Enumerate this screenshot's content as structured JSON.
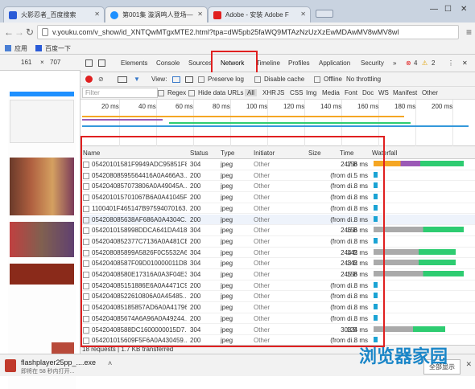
{
  "tabs": [
    {
      "title": "火影忍者_百度搜索",
      "favicon_color": "#2a5bd7"
    },
    {
      "title": "第001集 漩涡鸣人登场—",
      "favicon_color": "#1e90ff"
    },
    {
      "title": "Adobe - 安装 Adobe F",
      "favicon_color": "#e02020"
    }
  ],
  "address": {
    "url": "v.youku.com/v_show/id_XNTQwMTgxMTE2.html?tpa=dW5pb25faWQ9MTAzNzUzXzEwMDAwMV8wMV8wl"
  },
  "bookmarks": [
    "应用",
    "百度一下"
  ],
  "viewport": {
    "width": "161",
    "height": "707"
  },
  "devtools": {
    "tabs": [
      "Elements",
      "Console",
      "Sources",
      "Network",
      "Timeline",
      "Profiles",
      "Application",
      "Security",
      "»"
    ],
    "errors": "4",
    "warnings": "2",
    "controls": {
      "view": "View:",
      "preserve": "Preserve log",
      "disable_cache": "Disable cache",
      "offline": "Offline",
      "throttle": "No throttling"
    },
    "filter": {
      "placeholder": "Filter",
      "regex": "Regex",
      "hide": "Hide data URLs",
      "types": [
        "All",
        "XHR",
        "JS",
        "CSS",
        "Img",
        "Media",
        "Font",
        "Doc",
        "WS",
        "Manifest",
        "Other"
      ]
    }
  },
  "timeline_ticks": [
    "20 ms",
    "40 ms",
    "60 ms",
    "80 ms",
    "100 ms",
    "120 ms",
    "140 ms",
    "160 ms",
    "180 ms",
    "200 ms"
  ],
  "columns": [
    "Name",
    "Status",
    "Type",
    "Initiator",
    "Size",
    "Time",
    "Waterfall"
  ],
  "rows": [
    {
      "name": "05420101581F9949ADC95851F8...",
      "status": "304",
      "type": "jpeg",
      "initiator": "Other",
      "size": "247 B",
      "time": "156 ms"
    },
    {
      "name": "05420808595564416A0A466A3...",
      "status": "200",
      "type": "jpeg",
      "initiator": "Other",
      "size": "(from di...",
      "time": "5 ms"
    },
    {
      "name": "0542040857073806A0A49045A...",
      "status": "200",
      "type": "jpeg",
      "initiator": "Other",
      "size": "(from di...",
      "time": "8 ms"
    },
    {
      "name": "054201015701067B6A0A41045F...",
      "status": "200",
      "type": "jpeg",
      "initiator": "Other",
      "size": "(from di...",
      "time": "8 ms"
    },
    {
      "name": "1100401F465147B97594070163...",
      "status": "200",
      "type": "jpeg",
      "initiator": "Other",
      "size": "(from di...",
      "time": "8 ms"
    },
    {
      "name": "054208085638AF686A0A4304C...",
      "status": "200",
      "type": "jpeg",
      "initiator": "Other",
      "size": "(from di...",
      "time": "8 ms"
    },
    {
      "name": "0542010158998DDCA641DA4182...",
      "status": "304",
      "type": "jpeg",
      "initiator": "Other",
      "size": "246 B",
      "time": "156 ms"
    },
    {
      "name": "0542040852377C7136A0A481CE...",
      "status": "200",
      "type": "jpeg",
      "initiator": "Other",
      "size": "(from di...",
      "time": "8 ms"
    },
    {
      "name": "054208085899A5826F0C5532A6...",
      "status": "304",
      "type": "jpeg",
      "initiator": "Other",
      "size": "244 B",
      "time": "142 ms"
    },
    {
      "name": "05420408587F09D010000011D8D...",
      "status": "304",
      "type": "jpeg",
      "initiator": "Other",
      "size": "243 B",
      "time": "142 ms"
    },
    {
      "name": "05420408580E17316A0A3F04E3...",
      "status": "304",
      "type": "jpeg",
      "initiator": "Other",
      "size": "245 B",
      "time": "156 ms"
    },
    {
      "name": "054204085151886E6A0A4471C9...",
      "status": "200",
      "type": "jpeg",
      "initiator": "Other",
      "size": "(from di...",
      "time": "8 ms"
    },
    {
      "name": "05420408522610806A0A45485...",
      "status": "200",
      "type": "jpeg",
      "initiator": "Other",
      "size": "(from di...",
      "time": "8 ms"
    },
    {
      "name": "054204085185857AD6A0A41796...",
      "status": "200",
      "type": "jpeg",
      "initiator": "Other",
      "size": "(from di...",
      "time": "8 ms"
    },
    {
      "name": "054204085674A6A96A0A49244...",
      "status": "200",
      "type": "jpeg",
      "initiator": "Other",
      "size": "(from di...",
      "time": "8 ms"
    },
    {
      "name": "05420408588DC1600000015D7...",
      "status": "304",
      "type": "jpeg",
      "initiator": "Other",
      "size": "308 B",
      "time": "124 ms"
    },
    {
      "name": "054201015609F5F6A0A430459...",
      "status": "200",
      "type": "jpeg",
      "initiator": "Other",
      "size": "(from di...",
      "time": "8 ms"
    }
  ],
  "summary": "18 requests | 1.7 KB transferred",
  "download": {
    "file": "flashplayer25pp_....exe",
    "sub": "即将在 58 秒内打开..."
  },
  "show_all": "全部显示",
  "watermark": "浏览器家园"
}
